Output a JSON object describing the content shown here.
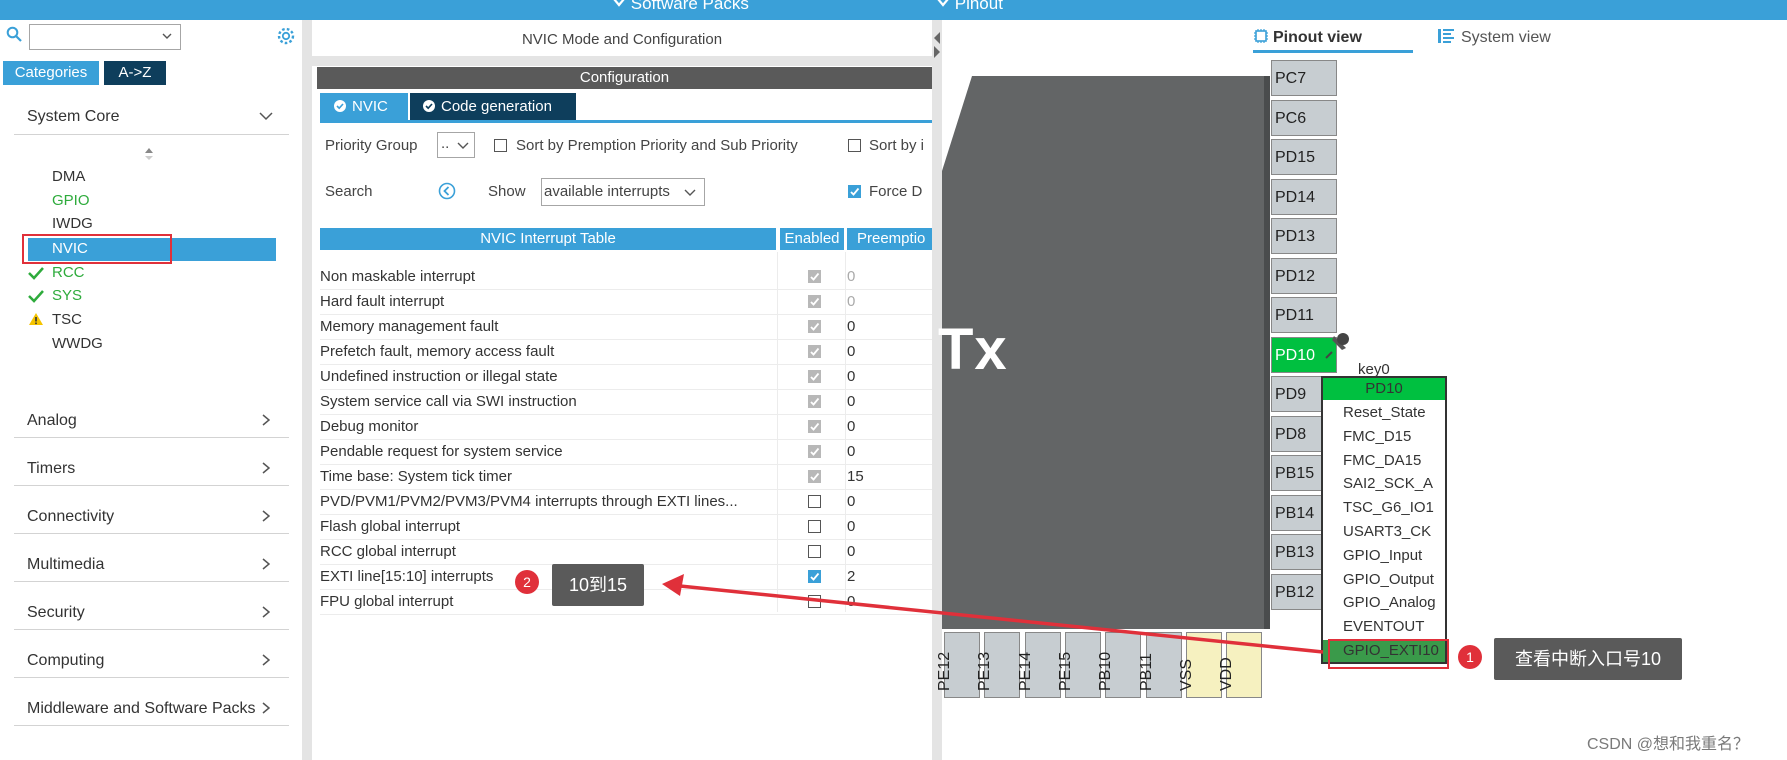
{
  "topbar": {
    "software_packs": "Software Packs",
    "pinout": "Pinout"
  },
  "left": {
    "tab_categories": "Categories",
    "tab_az": "A->Z",
    "system_core": "System Core",
    "items": [
      "DMA",
      "GPIO",
      "IWDG",
      "NVIC",
      "RCC",
      "SYS",
      "TSC",
      "WWDG"
    ],
    "sections": [
      "Analog",
      "Timers",
      "Connectivity",
      "Multimedia",
      "Security",
      "Computing",
      "Middleware and Software Packs"
    ]
  },
  "mid": {
    "header": "NVIC Mode and Configuration",
    "configuration": "Configuration",
    "tab_nvic": "NVIC",
    "tab_code": "Code generation",
    "priority_group": "Priority Group",
    "priority_group_value": "..",
    "sort_premption": "Sort by Premption Priority and Sub Priority",
    "sort_by": "Sort by i",
    "search": "Search",
    "show": "Show",
    "show_value": "available interrupts",
    "force": "Force D",
    "col_table": "NVIC Interrupt Table",
    "col_enabled": "Enabled",
    "col_preemption": "Preemptio",
    "rows": [
      {
        "name": "Non maskable interrupt",
        "enabled": true,
        "locked": true,
        "prio": "0"
      },
      {
        "name": "Hard fault interrupt",
        "enabled": true,
        "locked": true,
        "prio": "0"
      },
      {
        "name": "Memory management fault",
        "enabled": true,
        "locked": true,
        "prio": "0"
      },
      {
        "name": "Prefetch fault, memory access fault",
        "enabled": true,
        "locked": true,
        "prio": "0"
      },
      {
        "name": "Undefined instruction or illegal state",
        "enabled": true,
        "locked": true,
        "prio": "0"
      },
      {
        "name": "System service call via SWI instruction",
        "enabled": true,
        "locked": true,
        "prio": "0"
      },
      {
        "name": "Debug monitor",
        "enabled": true,
        "locked": true,
        "prio": "0"
      },
      {
        "name": "Pendable request for system service",
        "enabled": true,
        "locked": true,
        "prio": "0"
      },
      {
        "name": "Time base: System tick timer",
        "enabled": true,
        "locked": true,
        "prio": "15"
      },
      {
        "name": "PVD/PVM1/PVM2/PVM3/PVM4 interrupts through EXTI lines...",
        "enabled": false,
        "locked": false,
        "prio": "0"
      },
      {
        "name": "Flash global interrupt",
        "enabled": false,
        "locked": false,
        "prio": "0"
      },
      {
        "name": "RCC global interrupt",
        "enabled": false,
        "locked": false,
        "prio": "0"
      },
      {
        "name": "EXTI line[15:10] interrupts",
        "enabled": true,
        "locked": false,
        "prio": "2"
      },
      {
        "name": "FPU global interrupt",
        "enabled": false,
        "locked": false,
        "prio": "0"
      }
    ]
  },
  "right": {
    "pinout_view": "Pinout view",
    "system_view": "System view",
    "chip_text": "Tx",
    "pins_right": [
      "PC7",
      "PC6",
      "PD15",
      "PD14",
      "PD13",
      "PD12",
      "PD11",
      "PD10",
      "PD9",
      "PD8",
      "PB15",
      "PB14",
      "PB13",
      "PB12"
    ],
    "pins_bottom": [
      "PE12",
      "PE13",
      "PE14",
      "PE15",
      "PB10",
      "PB11",
      "VSS",
      "VDD"
    ],
    "pin_label": "key0",
    "menu_title": "PD10",
    "menu_items": [
      "Reset_State",
      "FMC_D15",
      "FMC_DA15",
      "SAI2_SCK_A",
      "TSC_G6_IO1",
      "USART3_CK",
      "GPIO_Input",
      "GPIO_Output",
      "GPIO_Analog",
      "EVENTOUT",
      "GPIO_EXTI10"
    ]
  },
  "annotations": {
    "badge1": "1",
    "badge2": "2",
    "callout1": "查看中断入口号10",
    "callout2": "10到15"
  },
  "watermark": "CSDN @想和我重名？",
  "colors": {
    "accent": "#3aa0d8",
    "dark_tab": "#0e3e5c",
    "green": "#00c040",
    "red": "#e0303a"
  }
}
